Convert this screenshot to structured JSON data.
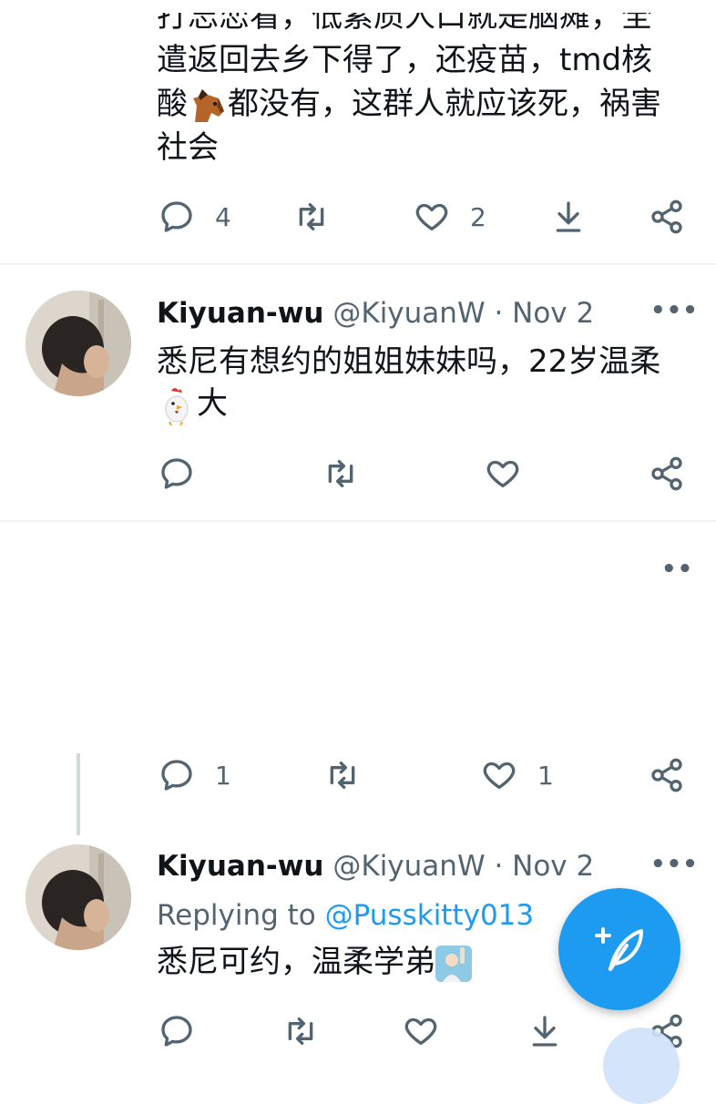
{
  "tweets": [
    {
      "text_partial_top": "打忘恋看，低素质人口就是脑瘫，全",
      "text_line2": "遣返回去乡下得了，还疫苗，tmd核",
      "text_line3_a": "酸",
      "text_line3_b": "都没有，这群人就应该死，祸害",
      "text_line4": "社会",
      "emoji_name": "horse-face-emoji",
      "actions": {
        "reply_count": "4",
        "retweet_count": "",
        "like_count": "2"
      }
    },
    {
      "name": "Kiyuan-wu",
      "handle": "@KiyuanW · Nov 2",
      "text_line1": "悉尼有想约的姐姐妹妹吗，22岁温柔",
      "text_line2": "大",
      "emoji_name": "rooster-emoji",
      "actions": {
        "reply_count": "",
        "retweet_count": "",
        "like_count": ""
      }
    },
    {
      "actions": {
        "reply_count": "1",
        "retweet_count": "",
        "like_count": "1"
      }
    },
    {
      "name": "Kiyuan-wu",
      "handle": "@KiyuanW · Nov 2",
      "replying_label": "Replying to",
      "replying_mention": "@Pusskitty013",
      "text_line1": "悉尼可约，温柔学弟",
      "emoji_name": "person-raising-hand-emoji"
    }
  ],
  "icons": {
    "reply": "reply-icon",
    "retweet": "retweet-icon",
    "like": "like-icon",
    "download": "download-icon",
    "share": "share-icon",
    "more": "more-icon",
    "compose": "compose-tweet-icon"
  },
  "colors": {
    "accent": "#1d9bf0",
    "text": "#0f1419",
    "secondary": "#536471",
    "divider": "#eff3f4"
  }
}
